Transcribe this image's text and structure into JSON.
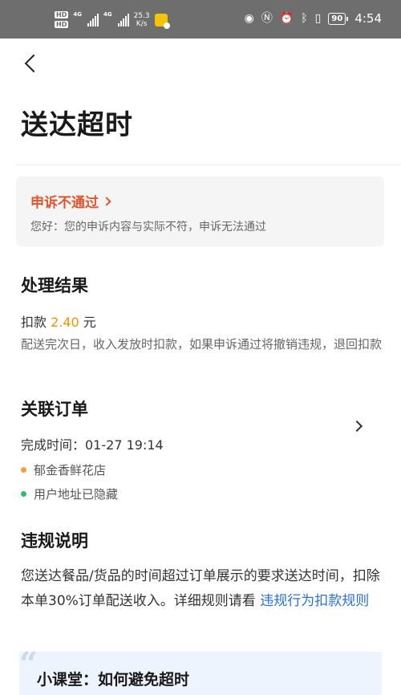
{
  "status_bar": {
    "hd1": "HD",
    "hd2": "HD",
    "net_label_1": "4G",
    "net_label_2": "4G",
    "speed_value": "25.3",
    "speed_unit": "K/s",
    "battery": "90",
    "time": "4:54"
  },
  "page": {
    "title": "送达超时"
  },
  "appeal": {
    "status": "申诉不通过",
    "message": "您好：您的申诉内容与实际不符，申诉无法通过"
  },
  "result": {
    "heading": "处理结果",
    "deduct_prefix": "扣款 ",
    "deduct_amount": "2.40",
    "deduct_unit": " 元",
    "description": "配送完次日，收入发放时扣款，如果申诉通过将撤销违规，退回扣款"
  },
  "order": {
    "heading": "关联订单",
    "completed_time": "完成时间：01-27 19:14",
    "shop": "郁金香鲜花店",
    "address": "用户地址已隐藏",
    "shop_dot_color": "#f0a040",
    "address_dot_color": "#2bbf6b"
  },
  "rule": {
    "heading": "违规说明",
    "text": "您送达餐品/货品的时间超过订单展示的要求送达时间，扣除本单30%订单配送收入。详细规则请看 ",
    "link": "违规行为扣款规则"
  },
  "tip": {
    "title": "小课堂：如何避免超时"
  }
}
